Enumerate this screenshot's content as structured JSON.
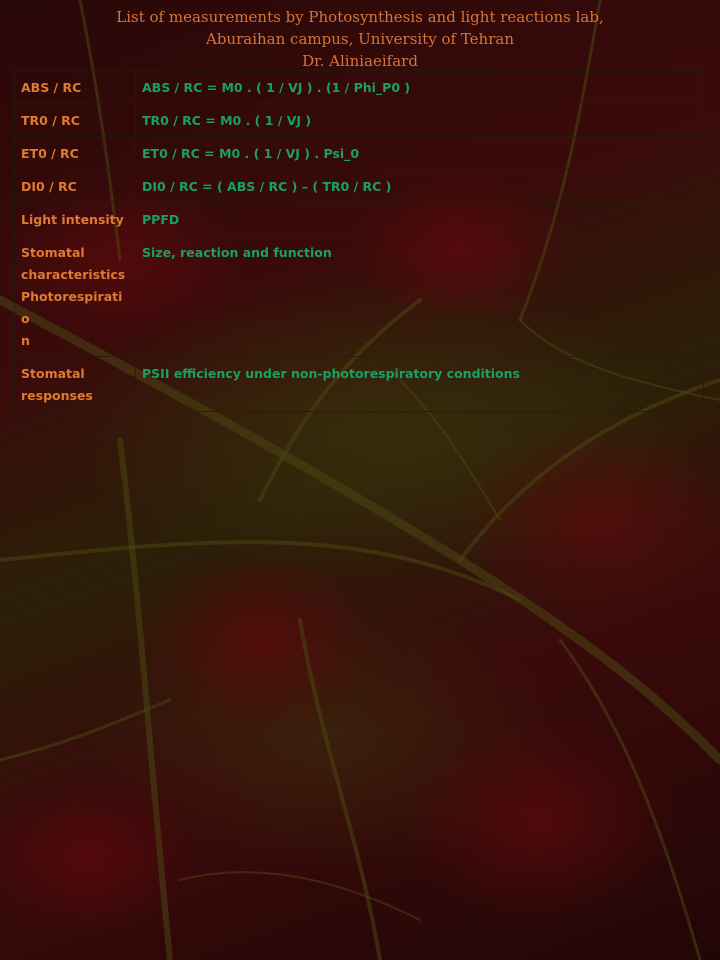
{
  "header": {
    "title_line1": "List of measurements by Photosynthesis and light reactions lab,",
    "title_line2": "Aburaihan campus, University of Tehran",
    "title_line3": "Dr. Aliniaeifard"
  },
  "table": {
    "rows": [
      {
        "label": "ABS / RC",
        "value": "ABS / RC = M0 . ( 1 / VJ ) . (1 / Phi_P0 )"
      },
      {
        "label": "TR0 / RC",
        "value": "TR0 / RC = M0 . ( 1 / VJ )"
      },
      {
        "label": "ET0 / RC",
        "value": "ET0 / RC = M0 . ( 1 / VJ ) . Psi_0"
      },
      {
        "label": "DI0 / RC",
        "value": "DI0 / RC = ( ABS / RC ) – ( TR0 / RC )"
      },
      {
        "label": "Light intensity",
        "value": "PPFD"
      },
      {
        "label_lines": [
          "Stomatal",
          "characteristics",
          "Photorespiratio",
          "n"
        ],
        "value": "Size, reaction and function"
      },
      {
        "label_lines": [
          "Stomatal",
          "responses"
        ],
        "value": "PSII efficiency under non-photorespiratory conditions"
      }
    ]
  },
  "colors": {
    "title": "#d87436",
    "label": "#e07a30",
    "value": "#19a064"
  }
}
